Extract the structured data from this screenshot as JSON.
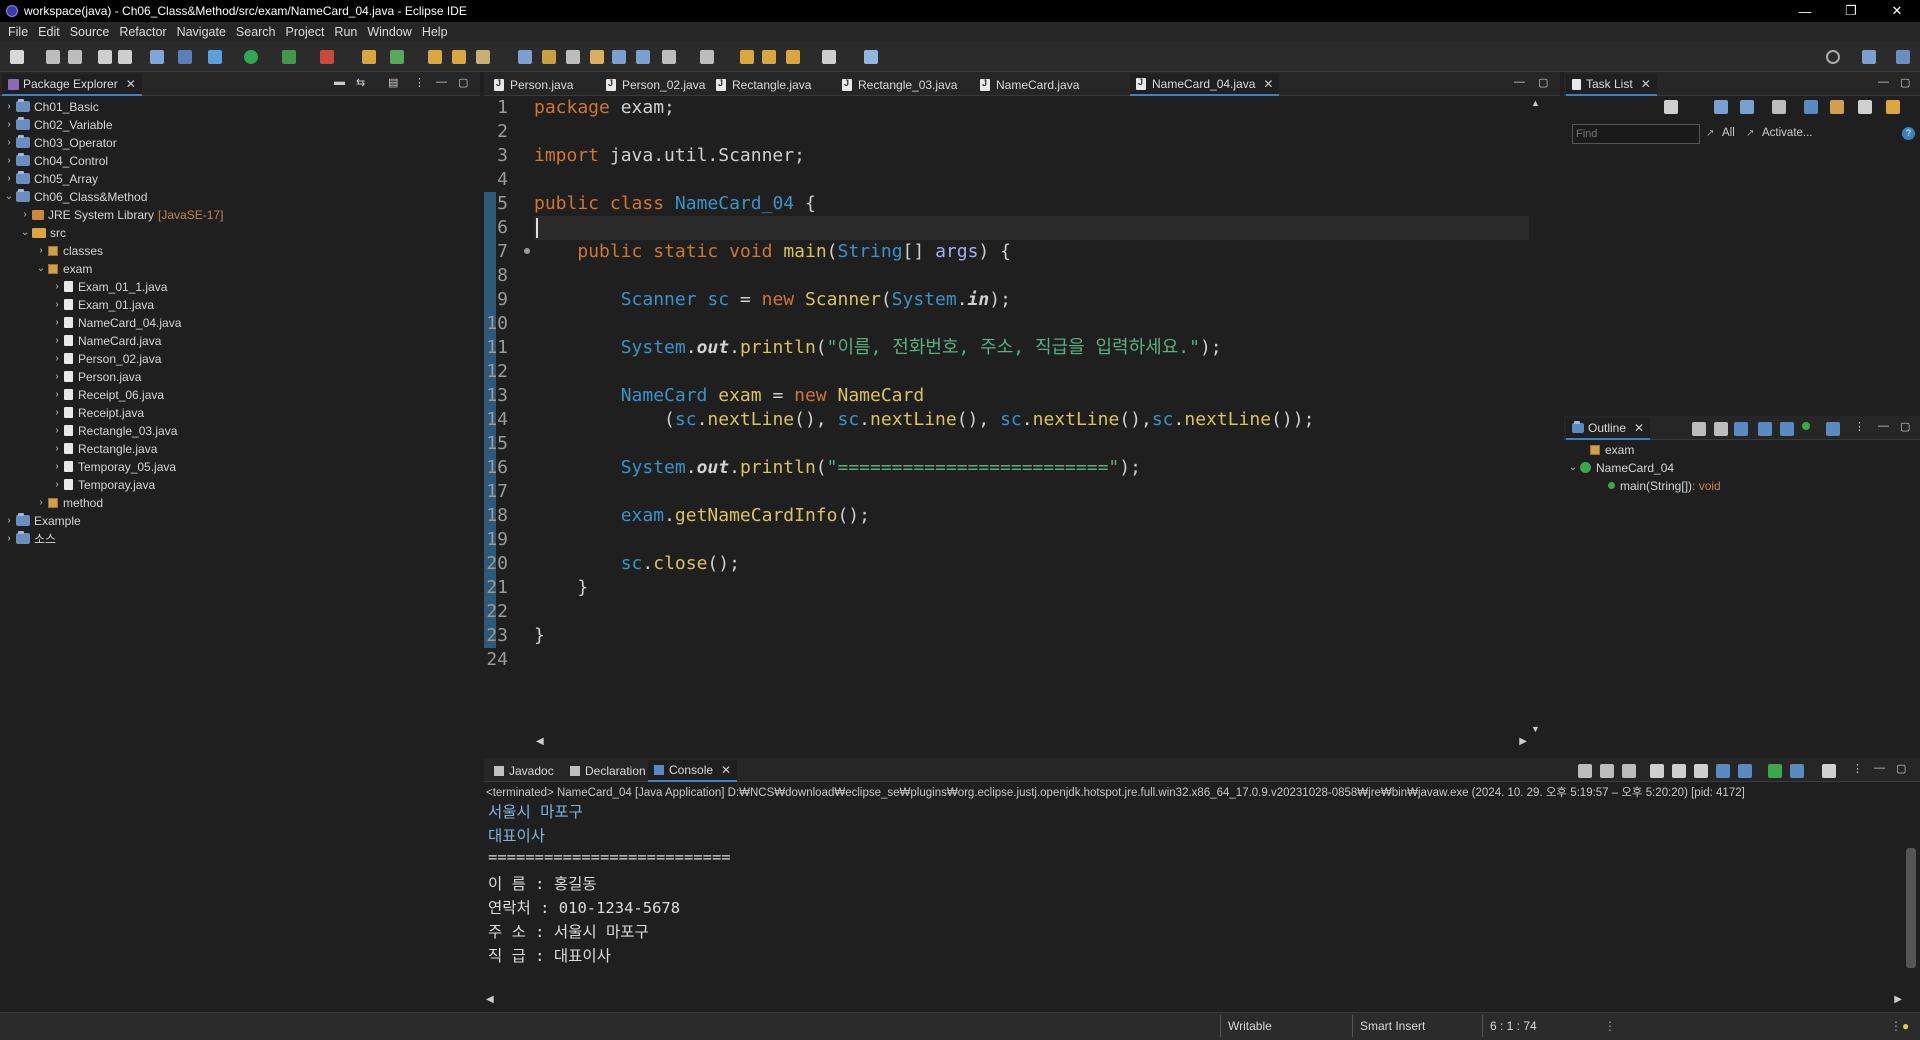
{
  "window": {
    "title": "workspace(java) - Ch06_Class&Method/src/exam/NameCard_04.java - Eclipse IDE",
    "minimize": "—",
    "restore": "❐",
    "close": "✕"
  },
  "menu": [
    "File",
    "Edit",
    "Source",
    "Refactor",
    "Navigate",
    "Search",
    "Project",
    "Run",
    "Window",
    "Help"
  ],
  "package_explorer": {
    "title": "Package Explorer",
    "close": "✕",
    "items": [
      {
        "label": "Ch01_Basic",
        "kind": "project",
        "depth": 0,
        "expanded": false
      },
      {
        "label": "Ch02_Variable",
        "kind": "project",
        "depth": 0,
        "expanded": false
      },
      {
        "label": "Ch03_Operator",
        "kind": "project",
        "depth": 0,
        "expanded": false
      },
      {
        "label": "Ch04_Control",
        "kind": "project",
        "depth": 0,
        "expanded": false
      },
      {
        "label": "Ch05_Array",
        "kind": "project",
        "depth": 0,
        "expanded": false
      },
      {
        "label": "Ch06_Class&Method",
        "kind": "project",
        "depth": 0,
        "expanded": true
      },
      {
        "label": "JRE System Library",
        "extra": "[JavaSE-17]",
        "kind": "library",
        "depth": 1,
        "expanded": false
      },
      {
        "label": "src",
        "kind": "folder",
        "depth": 1,
        "expanded": true
      },
      {
        "label": "classes",
        "kind": "package",
        "depth": 2,
        "expanded": false
      },
      {
        "label": "exam",
        "kind": "package",
        "depth": 2,
        "expanded": true
      },
      {
        "label": "Exam_01_1.java",
        "kind": "file",
        "depth": 3,
        "expanded": false
      },
      {
        "label": "Exam_01.java",
        "kind": "file",
        "depth": 3,
        "expanded": false
      },
      {
        "label": "NameCard_04.java",
        "kind": "file",
        "depth": 3,
        "expanded": false
      },
      {
        "label": "NameCard.java",
        "kind": "file",
        "depth": 3,
        "expanded": false
      },
      {
        "label": "Person_02.java",
        "kind": "file",
        "depth": 3,
        "expanded": false
      },
      {
        "label": "Person.java",
        "kind": "file",
        "depth": 3,
        "expanded": false
      },
      {
        "label": "Receipt_06.java",
        "kind": "file",
        "depth": 3,
        "expanded": false
      },
      {
        "label": "Receipt.java",
        "kind": "file",
        "depth": 3,
        "expanded": false
      },
      {
        "label": "Rectangle_03.java",
        "kind": "file",
        "depth": 3,
        "expanded": false
      },
      {
        "label": "Rectangle.java",
        "kind": "file",
        "depth": 3,
        "expanded": false
      },
      {
        "label": "Temporay_05.java",
        "kind": "file",
        "depth": 3,
        "expanded": false
      },
      {
        "label": "Temporay.java",
        "kind": "file",
        "depth": 3,
        "expanded": false
      },
      {
        "label": "method",
        "kind": "package",
        "depth": 2,
        "expanded": false
      },
      {
        "label": "Example",
        "kind": "project",
        "depth": 0,
        "expanded": false
      },
      {
        "label": "소스",
        "kind": "project",
        "depth": 0,
        "expanded": false
      }
    ]
  },
  "editor_tabs": [
    {
      "label": "Person.java",
      "active": false
    },
    {
      "label": "Person_02.java",
      "active": false
    },
    {
      "label": "Rectangle.java",
      "active": false
    },
    {
      "label": "Rectangle_03.java",
      "active": false
    },
    {
      "label": "NameCard.java",
      "active": false
    },
    {
      "label": "NameCard_04.java",
      "active": true
    }
  ],
  "editor": {
    "line_numbers": [
      "1",
      "2",
      "3",
      "4",
      "5",
      "6",
      "7",
      "8",
      "9",
      "10",
      "11",
      "12",
      "13",
      "14",
      "15",
      "16",
      "17",
      "18",
      "19",
      "20",
      "21",
      "22",
      "23",
      "24"
    ],
    "lines": [
      [
        [
          "kw",
          "package"
        ],
        [
          "pl",
          " exam;"
        ]
      ],
      [],
      [
        [
          "kw",
          "import"
        ],
        [
          "pl",
          " java.util.Scanner;"
        ]
      ],
      [],
      [
        [
          "kw",
          "public"
        ],
        [
          "pl",
          " "
        ],
        [
          "kw",
          "class"
        ],
        [
          "pl",
          " "
        ],
        [
          "ty",
          "NameCard_04"
        ],
        [
          "pl",
          " {"
        ]
      ],
      [],
      [
        [
          "pl",
          "    "
        ],
        [
          "kw",
          "public"
        ],
        [
          "pl",
          " "
        ],
        [
          "kw",
          "static"
        ],
        [
          "pl",
          " "
        ],
        [
          "kw",
          "void"
        ],
        [
          "pl",
          " "
        ],
        [
          "fn",
          "main"
        ],
        [
          "pl",
          "("
        ],
        [
          "ty",
          "String"
        ],
        [
          "pl",
          "[] "
        ],
        [
          "vr",
          "args"
        ],
        [
          "pl",
          ") {"
        ]
      ],
      [],
      [
        [
          "pl",
          "        "
        ],
        [
          "ty",
          "Scanner"
        ],
        [
          "pl",
          " "
        ],
        [
          "ty",
          "sc"
        ],
        [
          "pl",
          " = "
        ],
        [
          "kw",
          "new"
        ],
        [
          "pl",
          " "
        ],
        [
          "fn",
          "Scanner"
        ],
        [
          "pl",
          "("
        ],
        [
          "ty",
          "System"
        ],
        [
          "pl",
          "."
        ],
        [
          "fl",
          "in"
        ],
        [
          "pl",
          ");"
        ]
      ],
      [],
      [
        [
          "pl",
          "        "
        ],
        [
          "ty",
          "System"
        ],
        [
          "pl",
          "."
        ],
        [
          "fl",
          "out"
        ],
        [
          "pl",
          "."
        ],
        [
          "fn",
          "println"
        ],
        [
          "pl",
          "("
        ],
        [
          "st",
          "\"이름, 전화번호, 주소, 직급을 입력하세요.\""
        ],
        [
          "pl",
          ");"
        ]
      ],
      [],
      [
        [
          "pl",
          "        "
        ],
        [
          "ty",
          "NameCard"
        ],
        [
          "pl",
          " "
        ],
        [
          "fn",
          "exam"
        ],
        [
          "pl",
          " = "
        ],
        [
          "kw",
          "new"
        ],
        [
          "pl",
          " "
        ],
        [
          "fn",
          "NameCard"
        ]
      ],
      [
        [
          "pl",
          "            ("
        ],
        [
          "ty",
          "sc"
        ],
        [
          "pl",
          "."
        ],
        [
          "fn",
          "nextLine"
        ],
        [
          "pl",
          "(), "
        ],
        [
          "ty",
          "sc"
        ],
        [
          "pl",
          "."
        ],
        [
          "fn",
          "nextLine"
        ],
        [
          "pl",
          "(), "
        ],
        [
          "ty",
          "sc"
        ],
        [
          "pl",
          "."
        ],
        [
          "fn",
          "nextLine"
        ],
        [
          "pl",
          "(),"
        ],
        [
          "ty",
          "sc"
        ],
        [
          "pl",
          "."
        ],
        [
          "fn",
          "nextLine"
        ],
        [
          "pl",
          "());"
        ]
      ],
      [],
      [
        [
          "pl",
          "        "
        ],
        [
          "ty",
          "System"
        ],
        [
          "pl",
          "."
        ],
        [
          "fl",
          "out"
        ],
        [
          "pl",
          "."
        ],
        [
          "fn",
          "println"
        ],
        [
          "pl",
          "("
        ],
        [
          "st",
          "\"=========================\""
        ],
        [
          "pl",
          ");"
        ]
      ],
      [],
      [
        [
          "pl",
          "        "
        ],
        [
          "ty",
          "exam"
        ],
        [
          "pl",
          "."
        ],
        [
          "fn",
          "getNameCardInfo"
        ],
        [
          "pl",
          "();"
        ]
      ],
      [],
      [
        [
          "pl",
          "        "
        ],
        [
          "ty",
          "sc"
        ],
        [
          "pl",
          "."
        ],
        [
          "fn",
          "close"
        ],
        [
          "pl",
          "();"
        ]
      ],
      [
        [
          "pl",
          "    }"
        ]
      ],
      [],
      [
        [
          "pl",
          "}"
        ]
      ],
      []
    ]
  },
  "task_list": {
    "title": "Task List",
    "close": "✕",
    "find_placeholder": "Find",
    "all_label": "All",
    "activate_label": "Activate..."
  },
  "outline": {
    "title": "Outline",
    "close": "✕",
    "items": [
      {
        "label": "exam",
        "extra": "",
        "kind": "package"
      },
      {
        "label": "NameCard_04",
        "extra": "",
        "kind": "class"
      },
      {
        "label": "main(String[])",
        "extra": " : void",
        "kind": "method"
      }
    ]
  },
  "bottom_tabs": [
    {
      "label": "Javadoc",
      "active": false
    },
    {
      "label": "Declaration",
      "active": false
    },
    {
      "label": "Console",
      "active": true
    }
  ],
  "console": {
    "header": "<terminated> NameCard_04 [Java Application] D:₩NCS₩download₩eclipse_se₩plugins₩org.eclipse.justj.openjdk.hotspot.jre.full.win32.x86_64_17.0.9.v20231028-0858₩jre₩bin₩javaw.exe  (2024. 10. 29. 오후 5:19:57 – 오후 5:20:20) [pid: 4172]",
    "lines": [
      "서울시 마포구",
      "대표이사",
      "==========================",
      "이 름 : 홍길동",
      "연락처 : 010-1234-5678",
      "주 소 : 서울시 마포구",
      "직 급 : 대표이사"
    ]
  },
  "status": {
    "writable": "Writable",
    "insert_mode": "Smart Insert",
    "position": "6 : 1 : 74"
  },
  "colors": {
    "keyword": "#cc7832",
    "type": "#3a93c6",
    "method": "#d9c35a",
    "string": "#58b07f",
    "accent": "#3b82c4"
  }
}
